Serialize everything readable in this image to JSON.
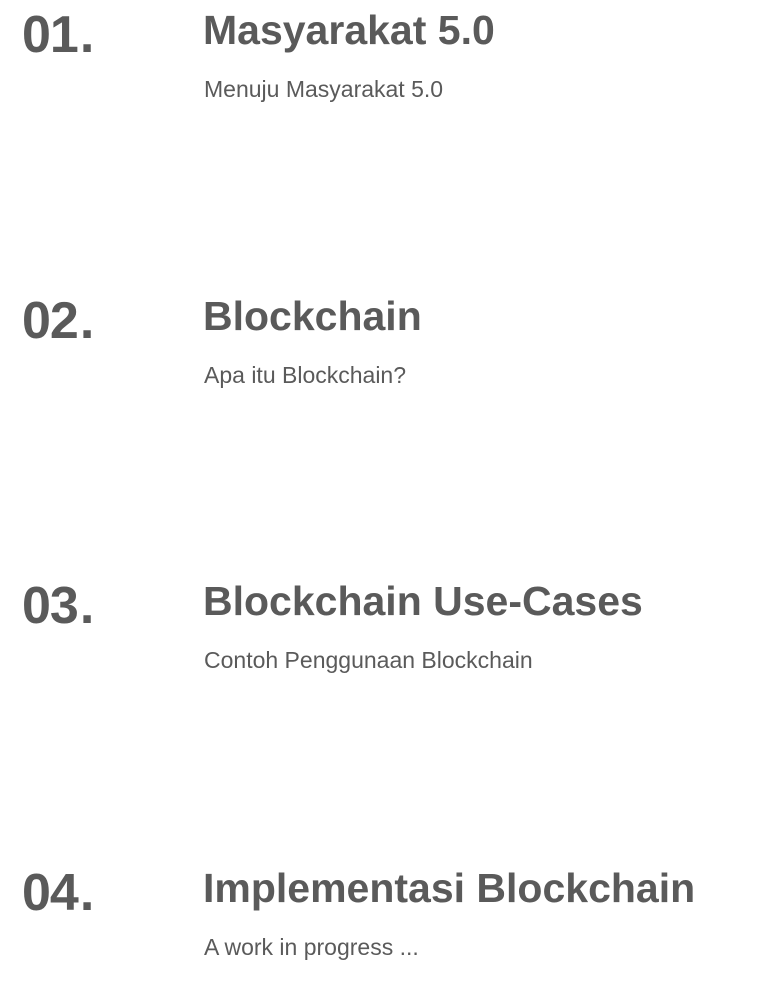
{
  "sections": [
    {
      "number": "01",
      "dot": ".",
      "title": "Masyarakat 5.0",
      "subtitle": "Menuju Masyarakat 5.0"
    },
    {
      "number": "02",
      "dot": ".",
      "title": "Blockchain",
      "subtitle": "Apa itu Blockchain?"
    },
    {
      "number": "03",
      "dot": ".",
      "title": "Blockchain Use-Cases",
      "subtitle": "Contoh Penggunaan Blockchain"
    },
    {
      "number": "04",
      "dot": ".",
      "title": "Implementasi Blockchain",
      "subtitle": "A work in progress ..."
    }
  ],
  "colors": {
    "text": "#5a5a5a",
    "background": "#ffffff"
  }
}
